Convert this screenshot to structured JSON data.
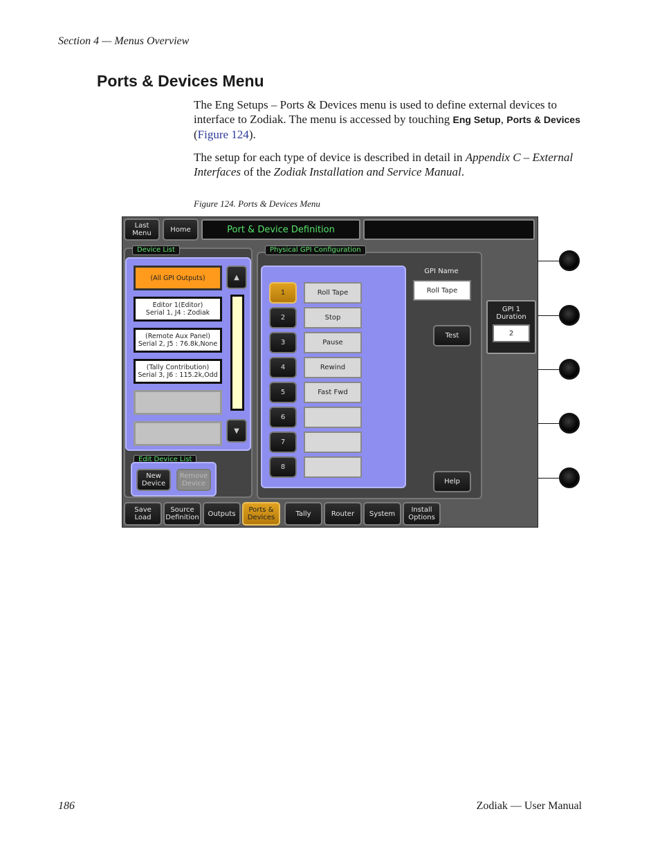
{
  "header": {
    "section": "Section 4 — Menus Overview"
  },
  "page_title": "Ports & Devices Menu",
  "para1": {
    "t1": "The Eng Setups – Ports & Devices menu is used to define external devices to interface to Zodiak. The menu is accessed by touching ",
    "ui1": "Eng Setup",
    "sep": ", ",
    "ui2": "Ports & Devices",
    "t2": " (",
    "link": "Figure 124",
    "t3": ")."
  },
  "para2": {
    "t1": "The setup for each type of device is described in detail in ",
    "i1": "Appendix C – External Interfaces",
    "t2": " of the ",
    "i2": "Zodiak Installation and Service Manual",
    "t3": "."
  },
  "figure_caption": "Figure 124.  Ports & Devices Menu",
  "screen": {
    "last_menu": "Last Menu",
    "home": "Home",
    "title": "Port & Device Definition",
    "device_list_label": "Device List",
    "devices": [
      {
        "l1": "(All GPI Outputs)",
        "l2": ""
      },
      {
        "l1": "Editor 1(Editor)",
        "l2": "Serial 1, J4 : Zodiak"
      },
      {
        "l1": "(Remote Aux Panel)",
        "l2": "Serial 2, J5 : 76.8k,None"
      },
      {
        "l1": "(Tally Contribution)",
        "l2": "Serial 3, J6 : 115.2k,Odd"
      }
    ],
    "up_arrow": "▲",
    "down_arrow": "▼",
    "edit_device_list_label": "Edit Device List",
    "new_device": "New Device",
    "remove_device": "Remove Device",
    "gpi_config_label": "Physical GPI Configuration",
    "gpi_numbers": [
      "1",
      "2",
      "3",
      "4",
      "5",
      "6",
      "7",
      "8"
    ],
    "gpi_names": [
      "Roll Tape",
      "Stop",
      "Pause",
      "Rewind",
      "Fast Fwd",
      "",
      "",
      ""
    ],
    "gpi_name_label": "GPI Name",
    "gpi_name_value": "Roll Tape",
    "test": "Test",
    "help": "Help",
    "duration_label": "GPI 1 Duration",
    "duration_value": "2",
    "tabs": [
      "Save Load",
      "Source Definition",
      "Outputs",
      "Ports & Devices",
      "Tally",
      "Router",
      "System",
      "Install Options"
    ]
  },
  "footer": {
    "page_number": "186",
    "manual": "Zodiak — User Manual"
  }
}
